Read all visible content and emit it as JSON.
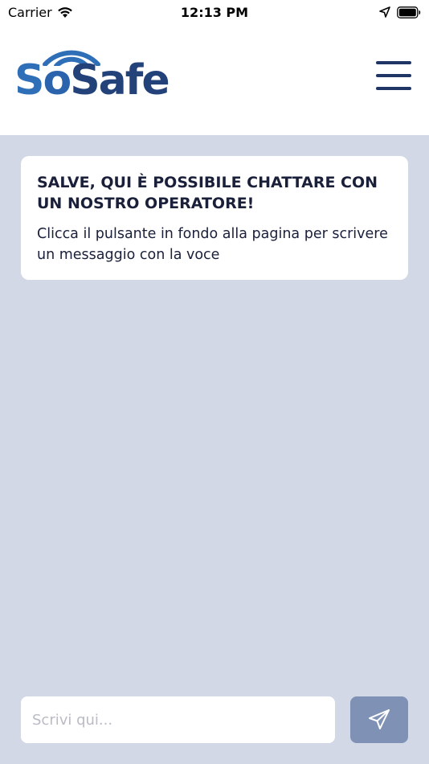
{
  "status_bar": {
    "carrier": "Carrier",
    "time": "12:13 PM"
  },
  "header": {
    "logo_part1": "S",
    "logo_part2": "o",
    "logo_part3": "Safe",
    "menu_icon": "hamburger-menu-icon"
  },
  "message": {
    "title": "SALVE, QUI È POSSIBILE CHATTARE CON UN NOSTRO OPERATORE!",
    "body": "Clicca il pulsante in fondo alla pagina per scrivere un messaggio con la voce"
  },
  "composer": {
    "placeholder": "Scrivi qui...",
    "send_icon": "paper-plane-icon"
  },
  "colors": {
    "background": "#d2d8e6",
    "brand_dark": "#1f3566",
    "brand_blue": "#2f6fb8",
    "send_button": "#7f92b6"
  }
}
